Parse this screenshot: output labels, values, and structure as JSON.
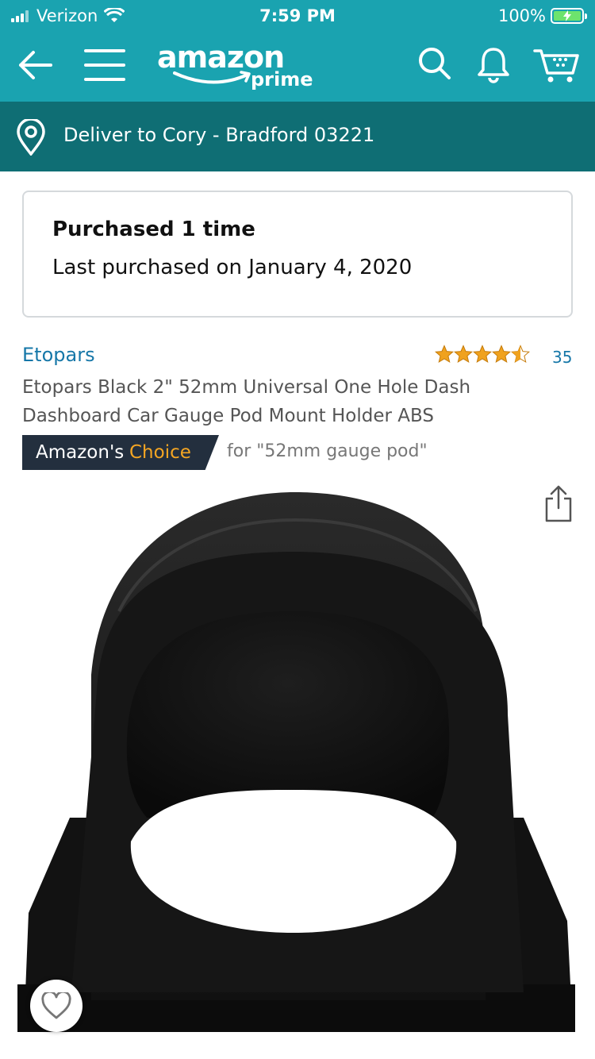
{
  "status_bar": {
    "carrier": "Verizon",
    "time": "7:59 PM",
    "battery": "100%"
  },
  "header": {
    "logo_word": "amazon",
    "logo_sub": "prime",
    "icons": [
      "back-arrow-icon",
      "menu-icon",
      "search-icon",
      "bell-icon",
      "cart-icon"
    ]
  },
  "deliver": {
    "text": "Deliver to Cory - Bradford 03221",
    "icon": "location-pin-icon"
  },
  "purchase_history": {
    "count_text": "Purchased 1 time",
    "last_text": "Last purchased on January 4, 2020"
  },
  "product": {
    "brand": "Etopars",
    "rating_stars": 4.5,
    "rating_count": "35",
    "title": "Etopars Black 2\" 52mm Universal One Hole Dash Dashboard Car Gauge Pod Mount Holder ABS",
    "badge_prefix": "Amazon's",
    "badge_choice": "Choice",
    "badge_for": "for \"52mm gauge pod\"",
    "image": "black gauge pod mount"
  },
  "colors": {
    "header_teal": "#1aa3b0",
    "deliver_teal": "#0f6e74",
    "link_blue": "#1677a8",
    "badge_dark": "#232f3e",
    "choice_orange": "#f5a623",
    "star_orange": "#f0a21e"
  }
}
